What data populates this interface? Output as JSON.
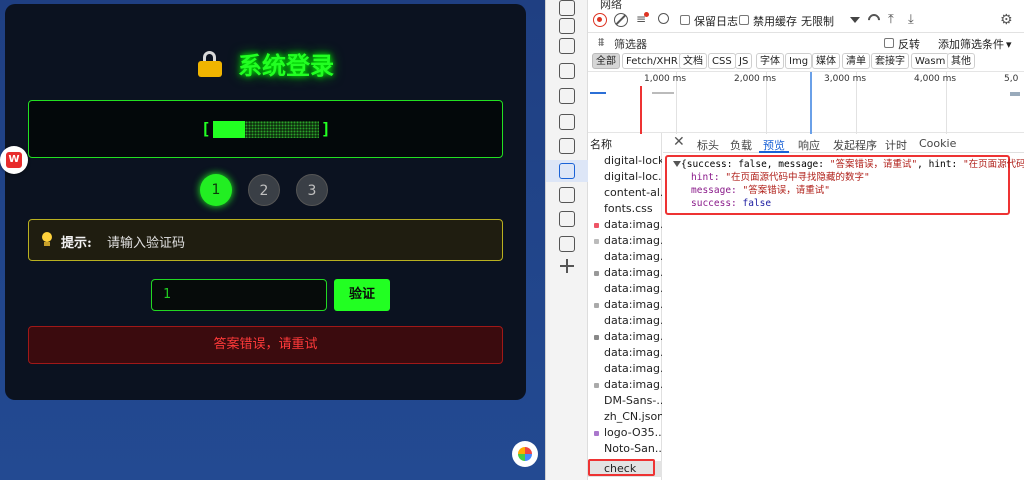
{
  "page": {
    "title": "系统登录",
    "steps": [
      "1",
      "2",
      "3"
    ],
    "hint_label": "提示:",
    "hint_text": "请输入验证码",
    "input_value": "1",
    "verify_label": "验证",
    "error_text": "答案错误，请重试",
    "progress_fraction": 0.3,
    "wps_logo": "W",
    "colors": {
      "accent": "#22ff22",
      "error": "#ff3a3a",
      "hint_border": "#b9b020"
    }
  },
  "devtools": {
    "panel_title": "网络",
    "toolbar": {
      "preserve_log": "保留日志",
      "disable_cache": "禁用缓存",
      "throttle": "无限制"
    },
    "filter_placeholder": "筛选器",
    "invert": "反转",
    "more_filters": "添加筛选条件",
    "type_filters": [
      "全部",
      "Fetch/XHR",
      "文档",
      "CSS",
      "JS",
      "字体",
      "Img",
      "媒体",
      "清单",
      "套接字",
      "Wasm",
      "其他"
    ],
    "timeline_ticks": [
      "1,000 ms",
      "2,000 ms",
      "3,000 ms",
      "4,000 ms",
      "5,0"
    ],
    "name_header": "名称",
    "requests": [
      "digital-lock",
      "digital-loc...",
      "content-al...",
      "fonts.css",
      "data:imag...",
      "data:imag...",
      "data:imag...",
      "data:imag...",
      "data:imag...",
      "data:imag...",
      "data:imag...",
      "data:imag...",
      "data:imag...",
      "data:imag...",
      "data:imag...",
      "DM-Sans-...",
      "zh_CN.json",
      "logo-O35...",
      "Noto-San...",
      "check"
    ],
    "detail_tabs": [
      "标头",
      "负载",
      "预览",
      "响应",
      "发起程序",
      "计时",
      "Cookie"
    ],
    "preview": {
      "summary_prefix": "{success: false, message: ",
      "summary_message": "\"答案错误，请重试\"",
      "summary_mid": ", hint: ",
      "summary_hint": "\"在页面源代码中寻",
      "hint_key": "hint: ",
      "hint_value": "\"在页面源代码中寻找隐藏的数字\"",
      "message_key": "message: ",
      "message_value": "\"答案错误，请重试\"",
      "success_key": "success: ",
      "success_value": "false"
    }
  }
}
